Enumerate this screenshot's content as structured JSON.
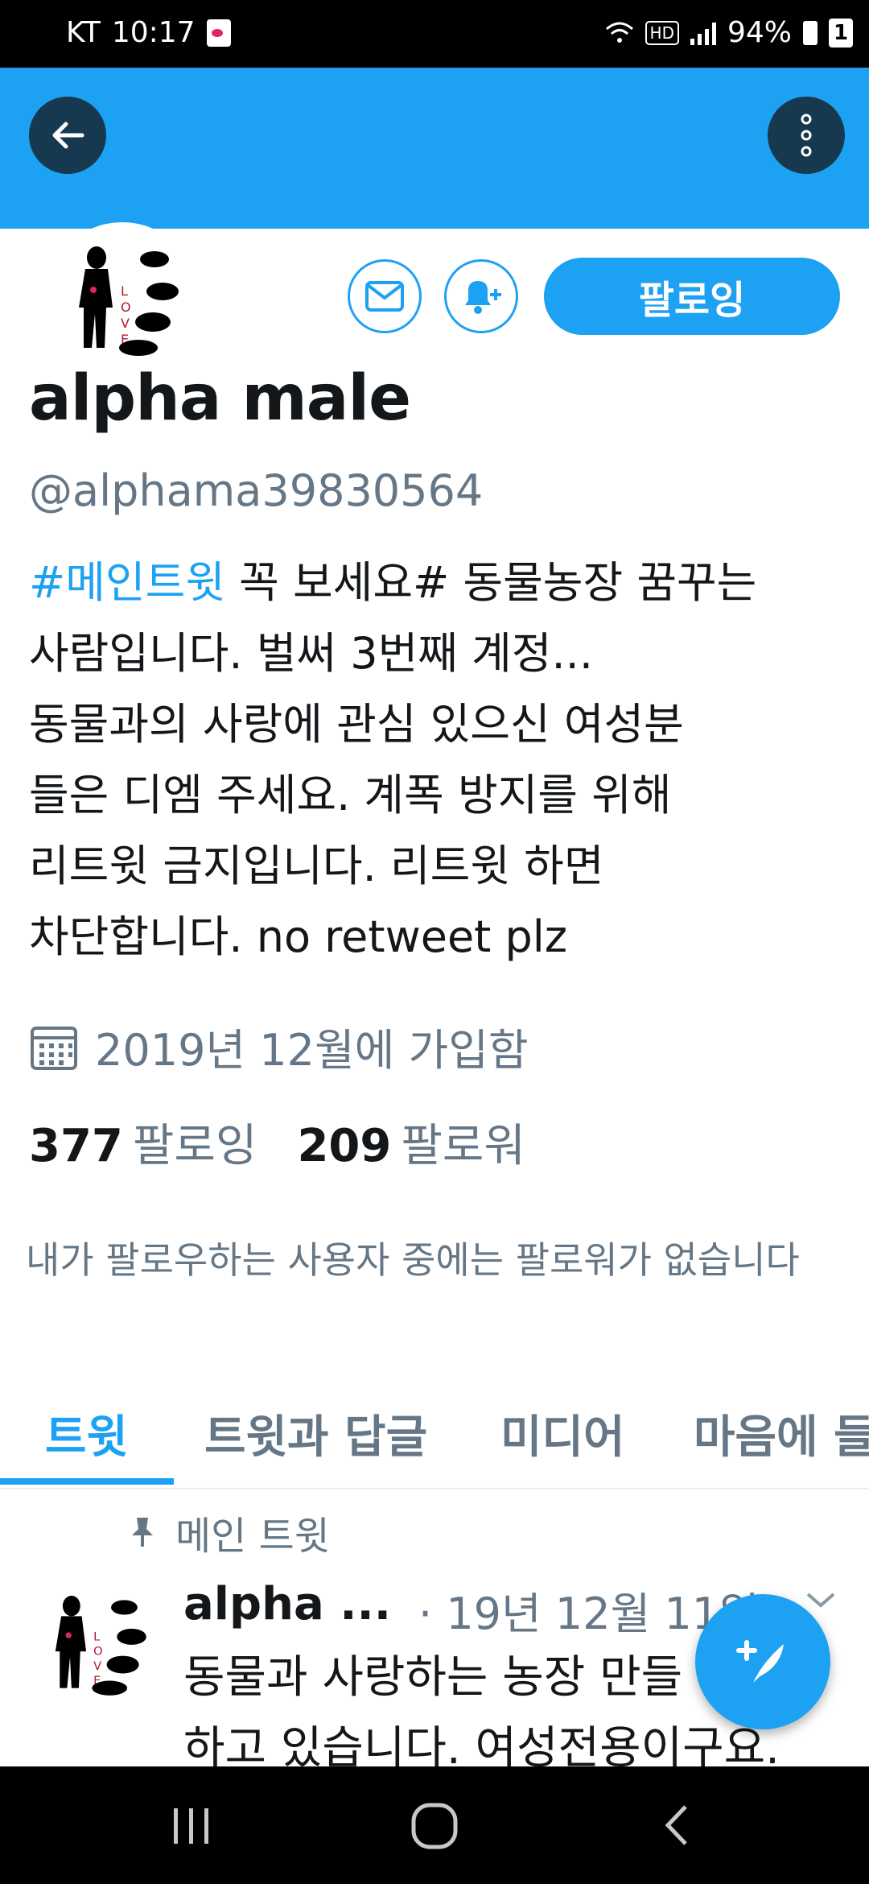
{
  "status_bar": {
    "carrier": "KT",
    "time": "10:17",
    "network_badge": "HD",
    "battery": "94%",
    "sim_slot": "1"
  },
  "profile": {
    "display_name": "alpha male",
    "handle": "@alphama39830564",
    "follow_button": "팔로잉",
    "bio": {
      "hashtag": "#메인트윗",
      "lines": [
        " 꼭 보세요# 동물농장 꿈꾸는",
        "사람입니다. 벌써 3번째 계정...",
        "동물과의 사랑에 관심 있으신 여성분",
        "들은 디엠 주세요. 계폭 방지를 위해",
        "리트윗 금지입니다. 리트윗 하면",
        "차단합니다. no retweet plz"
      ]
    },
    "joined": "2019년 12월에 가입함",
    "following_count": "377",
    "following_label": "팔로잉",
    "followers_count": "209",
    "followers_label": "팔로워",
    "mutual_notice": "내가 팔로우하는 사용자 중에는 팔로워가 없습니다"
  },
  "tabs": [
    "트윗",
    "트윗과 답글",
    "미디어",
    "마음에 들"
  ],
  "active_tab": "트윗",
  "pinned_tweet": {
    "pinned_label": "메인 트윗",
    "author": "alpha ...",
    "date": "· 19년 12월 11일",
    "text_lines": [
      "동물과 사랑하는 농장 만들",
      "하고 있습니다. 여성전용이구요."
    ]
  },
  "colors": {
    "accent": "#1da1f2",
    "secondary_text": "#657786",
    "primary_text": "#14171a"
  },
  "icons": {
    "back": "arrow-left-icon",
    "more": "more-vertical-icon",
    "message": "envelope-icon",
    "notify": "bell-plus-icon",
    "calendar": "calendar-icon",
    "pin": "pin-icon",
    "compose": "feather-plus-icon"
  }
}
